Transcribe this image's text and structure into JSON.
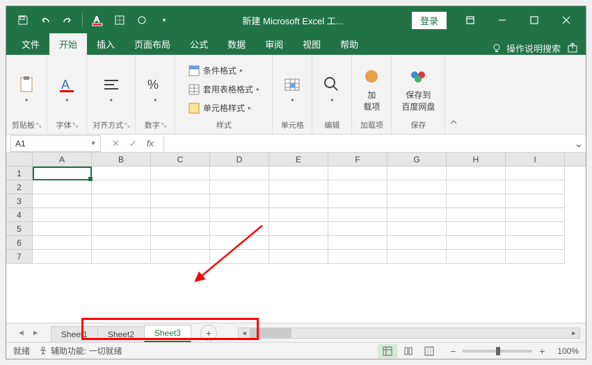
{
  "title": "新建 Microsoft Excel 工...",
  "login": "登录",
  "tabs": {
    "file": "文件",
    "home": "开始",
    "insert": "插入",
    "layout": "页面布局",
    "formulas": "公式",
    "data": "数据",
    "review": "审阅",
    "view": "视图",
    "help": "帮助"
  },
  "tellme": "操作说明搜索",
  "ribbon": {
    "clipboard": "剪贴板",
    "font": "字体",
    "align": "对齐方式",
    "number": "数字",
    "styles": "样式",
    "cond_format": "条件格式",
    "table_format": "套用表格格式",
    "cell_style": "单元格样式",
    "cells": "单元格",
    "editing": "编辑",
    "addin": "加载项",
    "addin_btn": "加\n载项",
    "save": "保存",
    "save_baidu": "保存到\n百度网盘"
  },
  "namebox": "A1",
  "columns": [
    "A",
    "B",
    "C",
    "D",
    "E",
    "F",
    "G",
    "H",
    "I"
  ],
  "rows": [
    "1",
    "2",
    "3",
    "4",
    "5",
    "6",
    "7"
  ],
  "sheets": [
    "Sheet1",
    "Sheet2",
    "Sheet3"
  ],
  "active_sheet": 2,
  "status": {
    "ready": "就绪",
    "acc": "辅助功能: 一切就绪",
    "zoom": "100%"
  }
}
